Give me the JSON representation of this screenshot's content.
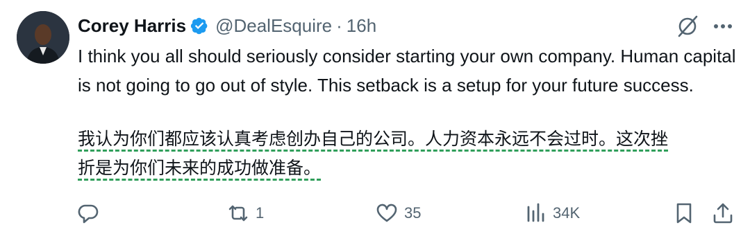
{
  "author": {
    "name": "Corey Harris",
    "handle": "@DealEsquire",
    "separator": "·",
    "time": "16h"
  },
  "post": {
    "text": "I think you all should seriously consider starting your own company. Human capital is not going to go out of style. This setback is a setup for your future success.",
    "translation_line1": "我认为你们都应该认真考虑创办自己的公司。人力资本永远不会过时。这次挫",
    "translation_line2": "折是为你们未来的成功做准备。"
  },
  "actions": {
    "reply_count": "",
    "repost_count": "1",
    "like_count": "35",
    "views_count": "34K"
  },
  "icons": {
    "verified": "verified-badge-icon",
    "grok": "grok-icon",
    "more": "more-icon",
    "reply": "reply-icon",
    "repost": "repost-icon",
    "like": "heart-icon",
    "views": "views-icon",
    "bookmark": "bookmark-icon",
    "share": "share-icon"
  },
  "colors": {
    "verified": "#1d9bf0",
    "muted": "#536471",
    "translation_underline": "#2f9e5a"
  }
}
